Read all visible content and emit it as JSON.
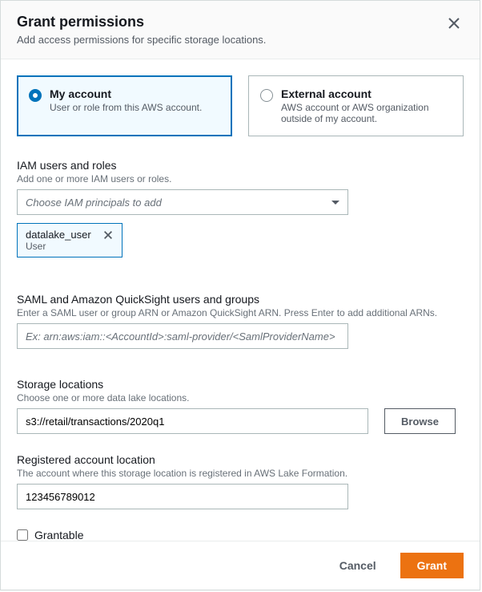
{
  "header": {
    "title": "Grant permissions",
    "subtitle": "Add access permissions for specific storage locations."
  },
  "accountType": {
    "myAccount": {
      "label": "My account",
      "desc": "User or role from this AWS account."
    },
    "external": {
      "label": "External account",
      "desc": "AWS account or AWS organization outside of my account."
    }
  },
  "iam": {
    "label": "IAM users and roles",
    "help": "Add one or more IAM users or roles.",
    "placeholder": "Choose IAM principals to add",
    "token": {
      "name": "datalake_user",
      "type": "User"
    }
  },
  "saml": {
    "label": "SAML and Amazon QuickSight users and groups",
    "help": "Enter a SAML user or group ARN or Amazon QuickSight ARN. Press Enter to add additional ARNs.",
    "placeholder": "Ex: arn:aws:iam::<AccountId>:saml-provider/<SamlProviderName>"
  },
  "storage": {
    "label": "Storage locations",
    "help": "Choose one or more data lake locations.",
    "value": "s3://retail/transactions/2020q1",
    "browseLabel": "Browse"
  },
  "registered": {
    "label": "Registered account location",
    "help": "The account where this storage location is registered in AWS Lake Formation.",
    "value": "123456789012"
  },
  "grantable": {
    "label": "Grantable"
  },
  "footer": {
    "cancel": "Cancel",
    "grant": "Grant"
  }
}
